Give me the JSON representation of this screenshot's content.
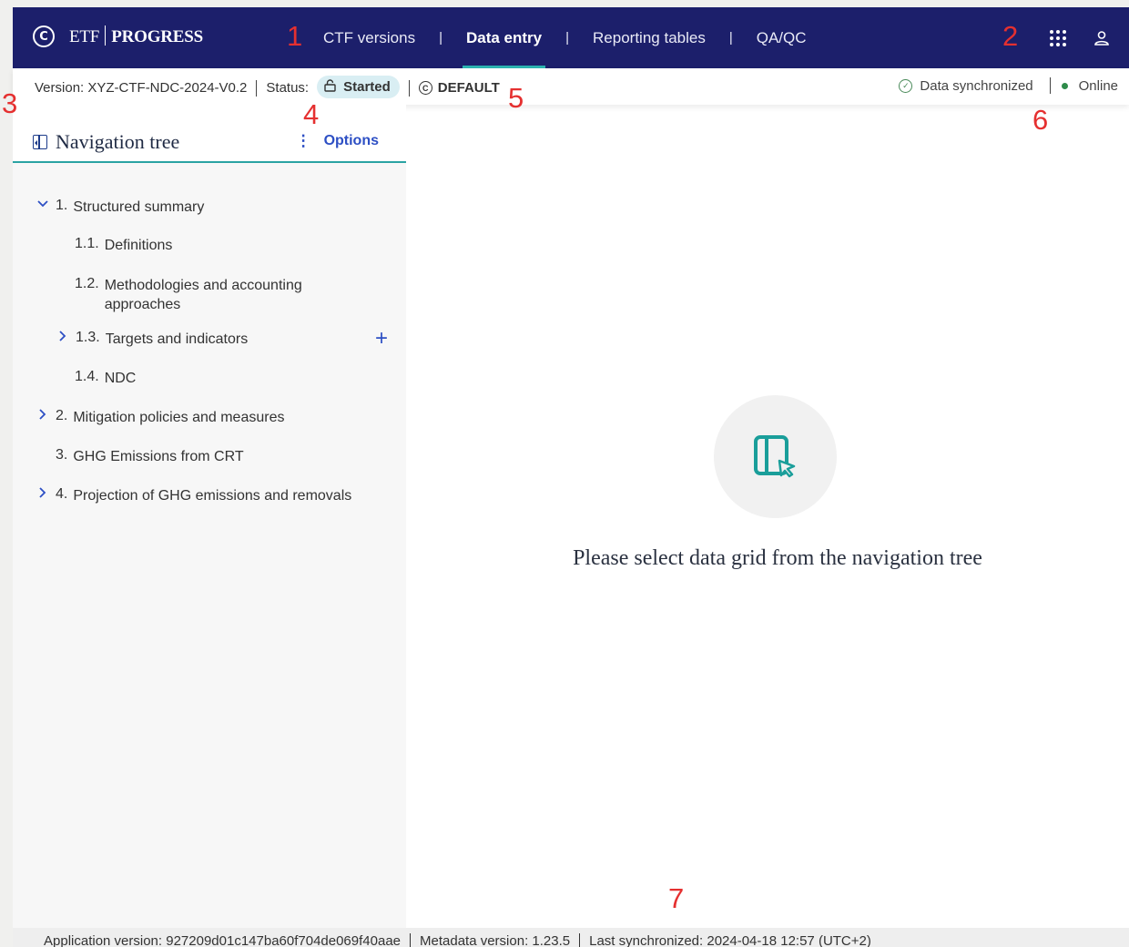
{
  "header": {
    "brand_prefix": "ETF",
    "brand_name": "PROGRESS",
    "nav": [
      {
        "label": "CTF versions",
        "active": false
      },
      {
        "label": "Data entry",
        "active": true
      },
      {
        "label": "Reporting tables",
        "active": false
      },
      {
        "label": "QA/QC",
        "active": false
      }
    ],
    "nav_separator": "|",
    "icons": [
      "un-emblem-icon",
      "apps-grid-icon",
      "user-icon"
    ],
    "colors": {
      "bar": "#1c1f6b",
      "active_underline": "#2cb3b0"
    }
  },
  "annotations": [
    "1",
    "2",
    "3",
    "4",
    "5",
    "6",
    "7"
  ],
  "status_bar": {
    "version": "Version: XYZ-CTF-NDC-2024-V0.2",
    "status_label": "Status:",
    "status_value": "Started",
    "default_label": "DEFAULT",
    "sync_text": "Data synchronized",
    "online_text": "Online",
    "colors": {
      "badge_bg": "#d9eef3",
      "online_dot": "#2e8b4a"
    }
  },
  "sidebar": {
    "title": "Navigation tree",
    "options_label": "Options",
    "tree": [
      {
        "num": "1.",
        "label": "Structured summary",
        "expanded": true
      },
      {
        "num": "1.1.",
        "label": "Definitions"
      },
      {
        "num": "1.2.",
        "label": "Methodologies and accounting approaches"
      },
      {
        "num": "1.3.",
        "label": "Targets and indicators",
        "expanded": false
      },
      {
        "num": "1.4.",
        "label": "NDC"
      },
      {
        "num": "2.",
        "label": "Mitigation policies and measures",
        "expanded": false
      },
      {
        "num": "3.",
        "label": "GHG Emissions from CRT"
      },
      {
        "num": "4.",
        "label": "Projection of GHG emissions and removals",
        "expanded": false
      }
    ],
    "add_icon": "plus-icon"
  },
  "main": {
    "empty_icon": "panel-select-cursor-icon",
    "empty_message": "Please select data grid from the navigation tree",
    "accent": "#1a9e9a"
  },
  "footer": {
    "app_version": "Application version: 927209d01c147ba60f704de069f40aae",
    "metadata_version": "Metadata version: 1.23.5",
    "last_synchronized": "Last synchronized: 2024-04-18 12:57 (UTC+2)"
  }
}
